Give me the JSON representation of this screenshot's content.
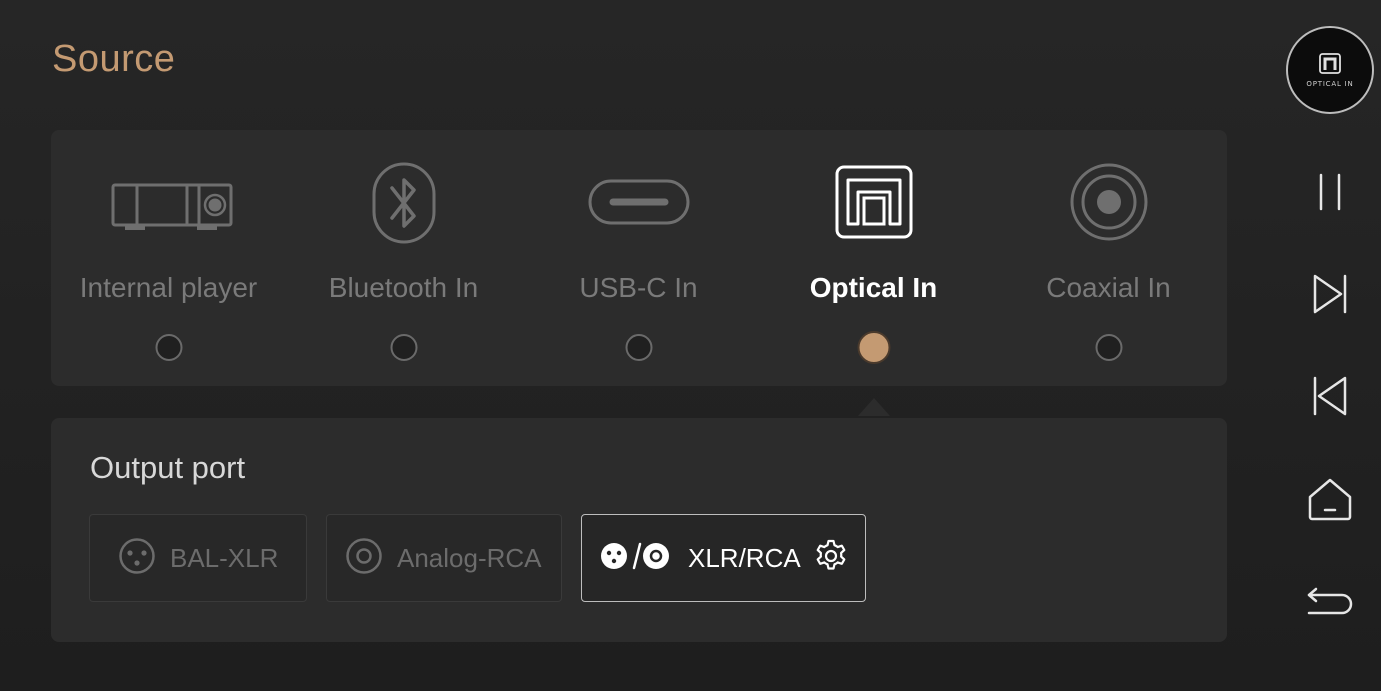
{
  "page": {
    "title": "Source"
  },
  "colors": {
    "accent": "#c49a72",
    "background": "#232323",
    "panel": "#2c2c2c",
    "inactive_text": "#7a7a7a",
    "active_text": "#ffffff"
  },
  "sources": {
    "selected": "Optical In",
    "items": [
      {
        "label": "Internal player",
        "icon": "internal-player-icon",
        "selected": false
      },
      {
        "label": "Bluetooth In",
        "icon": "bluetooth-icon",
        "selected": false
      },
      {
        "label": "USB-C In",
        "icon": "usb-c-icon",
        "selected": false
      },
      {
        "label": "Optical In",
        "icon": "optical-icon",
        "selected": true
      },
      {
        "label": "Coaxial In",
        "icon": "coaxial-icon",
        "selected": false
      }
    ]
  },
  "output": {
    "title": "Output port",
    "selected": "XLR/RCA",
    "ports": [
      {
        "label": "BAL-XLR",
        "icon": "xlr-icon",
        "selected": false
      },
      {
        "label": "Analog-RCA",
        "icon": "rca-icon",
        "selected": false
      },
      {
        "label": "XLR/RCA",
        "icon": "xlr-rca-icon",
        "selected": true,
        "settings_icon": "gear-icon"
      }
    ]
  },
  "sidebar": {
    "now_source_badge": {
      "text": "OPTICAL IN",
      "icon": "optical-icon"
    },
    "buttons": [
      {
        "name": "pause",
        "icon": "pause-icon"
      },
      {
        "name": "next",
        "icon": "skip-next-icon"
      },
      {
        "name": "previous",
        "icon": "skip-previous-icon"
      },
      {
        "name": "home",
        "icon": "home-icon"
      },
      {
        "name": "back",
        "icon": "back-icon"
      }
    ]
  }
}
